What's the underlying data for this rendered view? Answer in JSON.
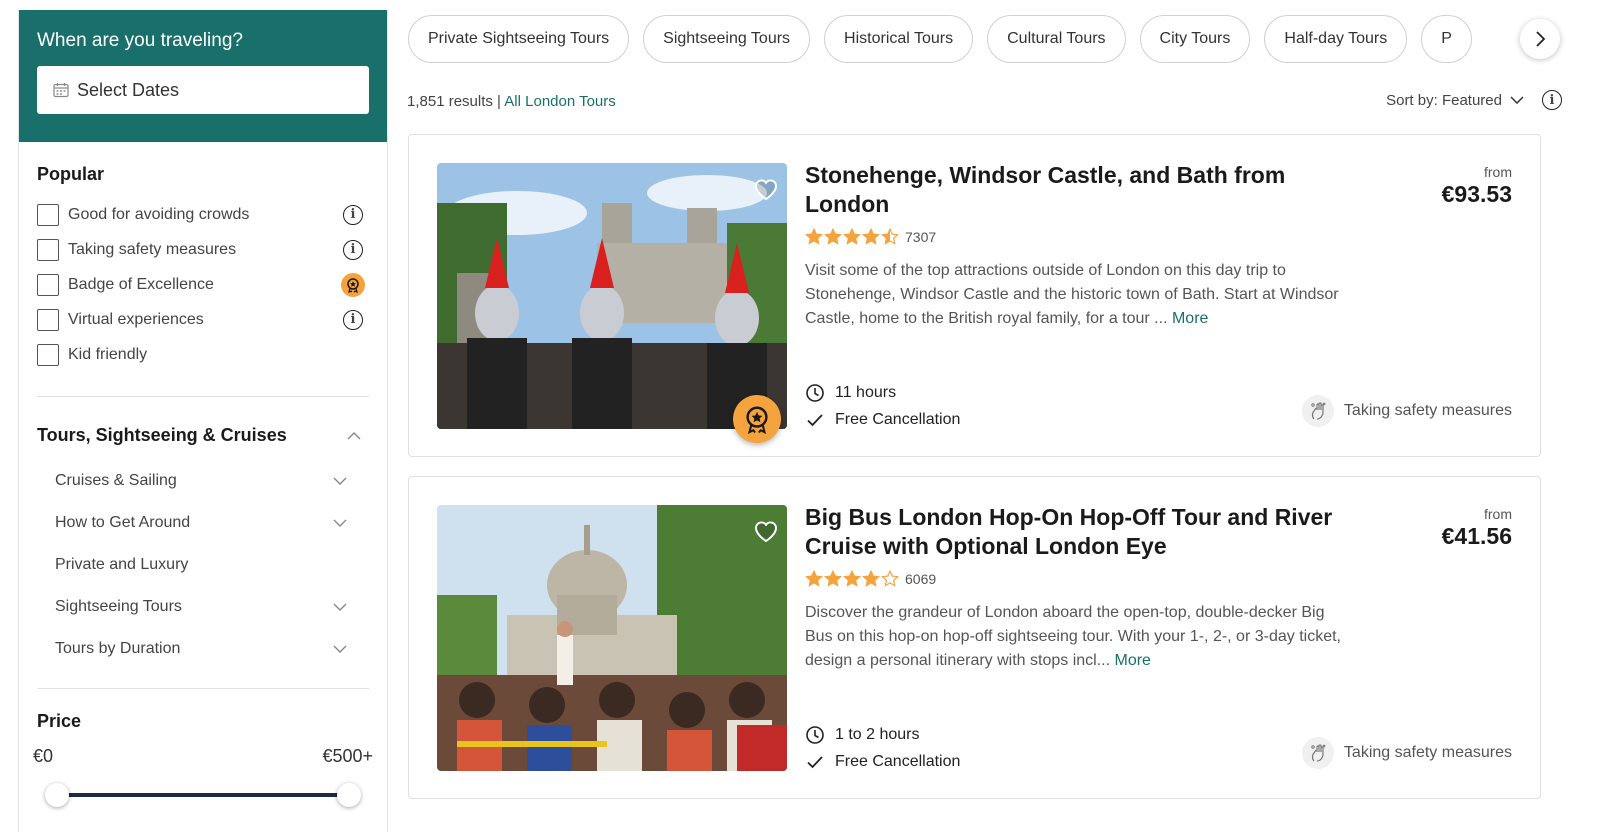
{
  "colors": {
    "brand": "#19706b",
    "badge": "#f5a33c",
    "star": "#f5a33c",
    "slider": "#1f2a44"
  },
  "sidebar": {
    "travel_title": "When are you traveling?",
    "date_placeholder": "Select Dates",
    "popular_title": "Popular",
    "popular_filters": [
      {
        "label": "Good for avoiding crowds",
        "checked": false,
        "icon": "info-icon"
      },
      {
        "label": "Taking safety measures",
        "checked": false,
        "icon": "info-icon"
      },
      {
        "label": "Badge of Excellence",
        "checked": false,
        "icon": "excellence-badge-icon"
      },
      {
        "label": "Virtual experiences",
        "checked": false,
        "icon": "info-icon"
      },
      {
        "label": "Kid friendly",
        "checked": false,
        "icon": ""
      }
    ],
    "category_title": "Tours, Sightseeing & Cruises",
    "category_items": [
      {
        "label": "Cruises & Sailing",
        "expandable": true
      },
      {
        "label": "How to Get Around",
        "expandable": true
      },
      {
        "label": "Private and Luxury",
        "expandable": false
      },
      {
        "label": "Sightseeing Tours",
        "expandable": true
      },
      {
        "label": "Tours by Duration",
        "expandable": true
      }
    ],
    "price_title": "Price",
    "price_min": "€0",
    "price_max": "€500+",
    "price_slider": {
      "min_fraction": 0,
      "max_fraction": 1
    }
  },
  "chips": [
    "Private Sightseeing Tours",
    "Sightseeing Tours",
    "Historical Tours",
    "Cultural Tours",
    "City Tours",
    "Half-day Tours",
    "P"
  ],
  "results": {
    "count": "1,851 results",
    "separator": " | ",
    "link": "All London Tours"
  },
  "sort": {
    "label": "Sort by: Featured"
  },
  "cards": [
    {
      "title": "Stonehenge, Windsor Castle, and Bath from London",
      "rating": 4.5,
      "reviews": "7307",
      "description": "Visit some of the top attractions outside of London on this day trip to Stonehenge, Windsor Castle and the historic town of Bath. Start at Windsor Castle, home to the British royal family, for a tour ...",
      "more": "More",
      "duration": "11 hours",
      "cancellation": "Free Cancellation",
      "price_from": "from",
      "price": "€93.53",
      "safety": "Taking safety measures",
      "badge": true
    },
    {
      "title": "Big Bus London Hop-On Hop-Off Tour and River Cruise with Optional London Eye",
      "rating": 4,
      "reviews": "6069",
      "description": "Discover the grandeur of London aboard the open-top, double-decker Big Bus on this hop-on hop-off sightseeing tour. With your 1-, 2-, or 3-day ticket, design a personal itinerary with stops incl...",
      "more": "More",
      "duration": "1 to 2 hours",
      "cancellation": "Free Cancellation",
      "price_from": "from",
      "price": "€41.56",
      "safety": "Taking safety measures",
      "badge": false
    }
  ]
}
